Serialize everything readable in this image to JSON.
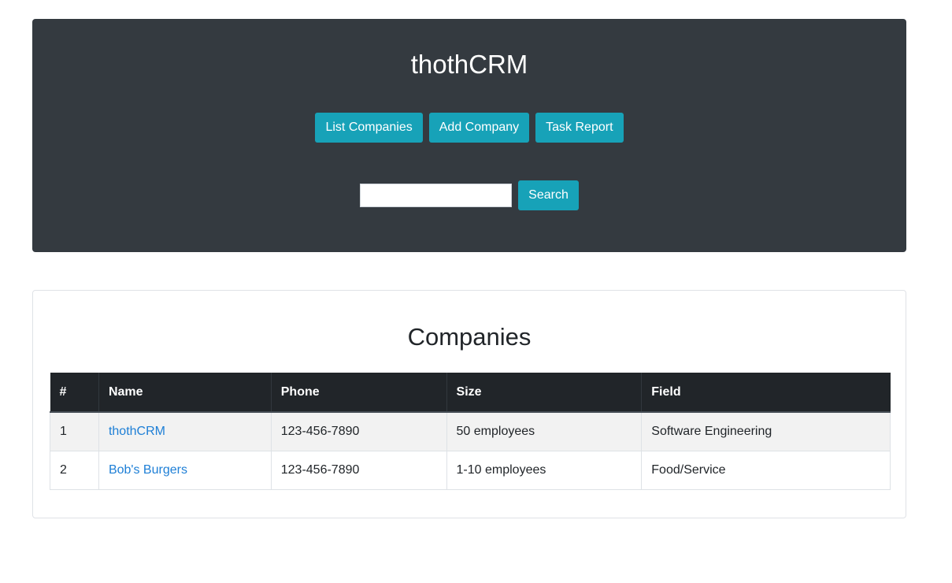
{
  "header": {
    "app_title": "thothCRM",
    "nav": {
      "list_companies": "List Companies",
      "add_company": "Add Company",
      "task_report": "Task Report"
    },
    "search": {
      "value": "",
      "placeholder": "",
      "button_label": "Search"
    }
  },
  "companies": {
    "title": "Companies",
    "columns": [
      "#",
      "Name",
      "Phone",
      "Size",
      "Field"
    ],
    "rows": [
      {
        "num": "1",
        "name": "thothCRM",
        "phone": "123-456-7890",
        "size": "50 employees",
        "field": "Software Engineering"
      },
      {
        "num": "2",
        "name": "Bob's Burgers",
        "phone": "123-456-7890",
        "size": "1-10 employees",
        "field": "Food/Service"
      }
    ]
  },
  "colors": {
    "header_bg": "#343a40",
    "button_bg": "#17a2b8",
    "table_head_bg": "#212529",
    "link": "#1e7fd6",
    "striped_row": "#f2f2f2"
  }
}
